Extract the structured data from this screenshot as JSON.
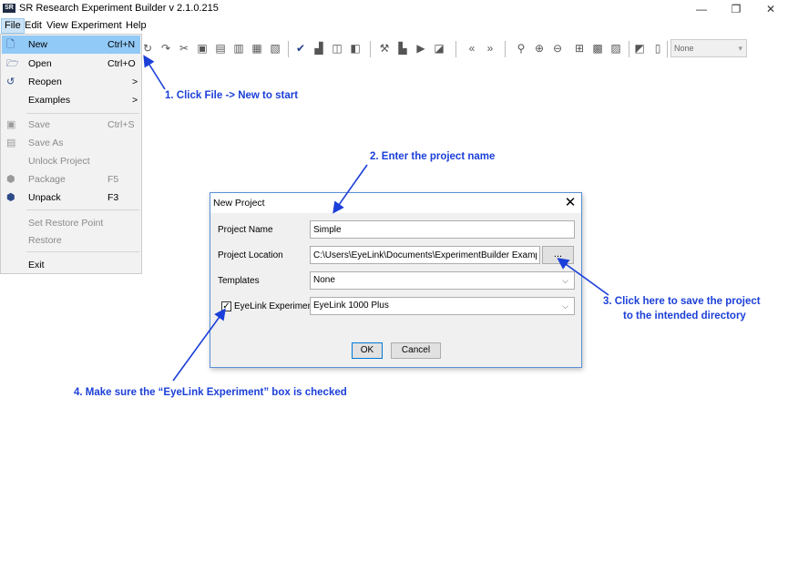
{
  "window": {
    "title": "SR Research Experiment Builder v 2.1.0.215",
    "app_icon_text": "SR"
  },
  "menubar": {
    "items": [
      "File",
      "Edit",
      "View",
      "Experiment",
      "Help"
    ]
  },
  "toolbar": {
    "combo_value": "None"
  },
  "file_menu": {
    "items": [
      {
        "label": "New",
        "shortcut": "Ctrl+N",
        "icon": "new-file-icon",
        "enabled": true,
        "highlighted": true
      },
      {
        "label": "Open",
        "shortcut": "Ctrl+O",
        "icon": "open-folder-icon",
        "enabled": true
      },
      {
        "label": "Reopen",
        "submenu": ">",
        "icon": "reopen-icon",
        "enabled": true
      },
      {
        "label": "Examples",
        "submenu": ">",
        "enabled": true
      },
      {
        "label": "Save",
        "shortcut": "Ctrl+S",
        "icon": "save-icon",
        "enabled": false
      },
      {
        "label": "Save As",
        "icon": "save-as-icon",
        "enabled": false
      },
      {
        "label": "Unlock Project",
        "enabled": false
      },
      {
        "label": "Package",
        "shortcut": "F5",
        "icon": "package-icon",
        "enabled": false
      },
      {
        "label": "Unpack",
        "shortcut": "F3",
        "icon": "unpack-icon",
        "enabled": true
      },
      {
        "label": "Set Restore Point",
        "enabled": false
      },
      {
        "label": "Restore",
        "enabled": false
      },
      {
        "label": "Exit",
        "enabled": true
      }
    ]
  },
  "dialog": {
    "title": "New Project",
    "close_symbol": "✕",
    "project_name_label": "Project Name",
    "project_name_value": "Simple",
    "project_location_label": "Project Location",
    "project_location_value": "C:\\Users\\EyeLink\\Documents\\ExperimentBuilder Examples",
    "browse_label": "...",
    "templates_label": "Templates",
    "templates_value": "None",
    "eyelink_label": "EyeLink Experiment",
    "eyelink_checked": true,
    "eyelink_value": "EyeLink 1000 Plus",
    "ok_label": "OK",
    "cancel_label": "Cancel"
  },
  "annotations": {
    "step1": "1. Click File -> New to start",
    "step2": "2. Enter the project name",
    "step3_line1": "3. Click here to save the project",
    "step3_line2": "to the intended directory",
    "step4": "4. Make sure the “EyeLink Experiment” box is checked"
  },
  "colors": {
    "annotation": "#1b3fd8",
    "menu_highlight": "#91c9f7",
    "dialog_border": "#5a8fd6"
  }
}
